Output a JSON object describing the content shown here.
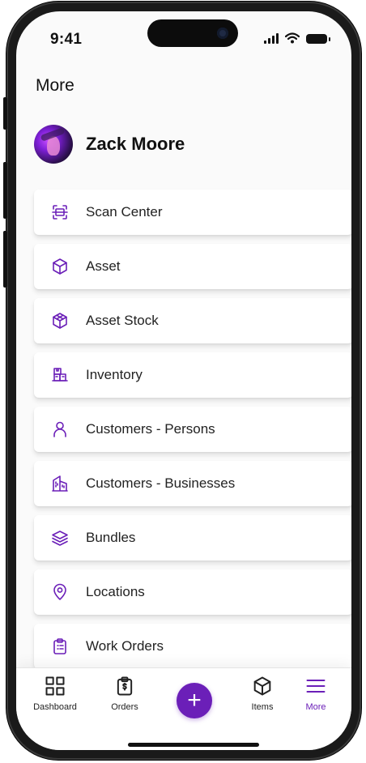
{
  "status_bar": {
    "time": "9:41"
  },
  "page": {
    "title": "More"
  },
  "profile": {
    "name": "Zack Moore"
  },
  "menu": {
    "items": [
      {
        "label": "Scan Center",
        "icon": "scan-icon"
      },
      {
        "label": "Asset",
        "icon": "box-icon"
      },
      {
        "label": "Asset Stock",
        "icon": "boxes-icon"
      },
      {
        "label": "Inventory",
        "icon": "inventory-icon"
      },
      {
        "label": "Customers - Persons",
        "icon": "person-icon"
      },
      {
        "label": "Customers - Businesses",
        "icon": "building-icon"
      },
      {
        "label": "Bundles",
        "icon": "layers-icon"
      },
      {
        "label": "Locations",
        "icon": "location-pin-icon"
      },
      {
        "label": "Work Orders",
        "icon": "clipboard-icon"
      }
    ]
  },
  "bottom_nav": {
    "items": [
      {
        "label": "Dashboard",
        "icon": "dashboard-icon"
      },
      {
        "label": "Orders",
        "icon": "orders-icon"
      },
      {
        "label": "Items",
        "icon": "box-icon"
      },
      {
        "label": "More",
        "icon": "menu-icon"
      }
    ],
    "fab_symbol": "+",
    "active": "More"
  },
  "colors": {
    "accent": "#6b1fb8",
    "background": "#fafafa",
    "text": "#222222"
  }
}
